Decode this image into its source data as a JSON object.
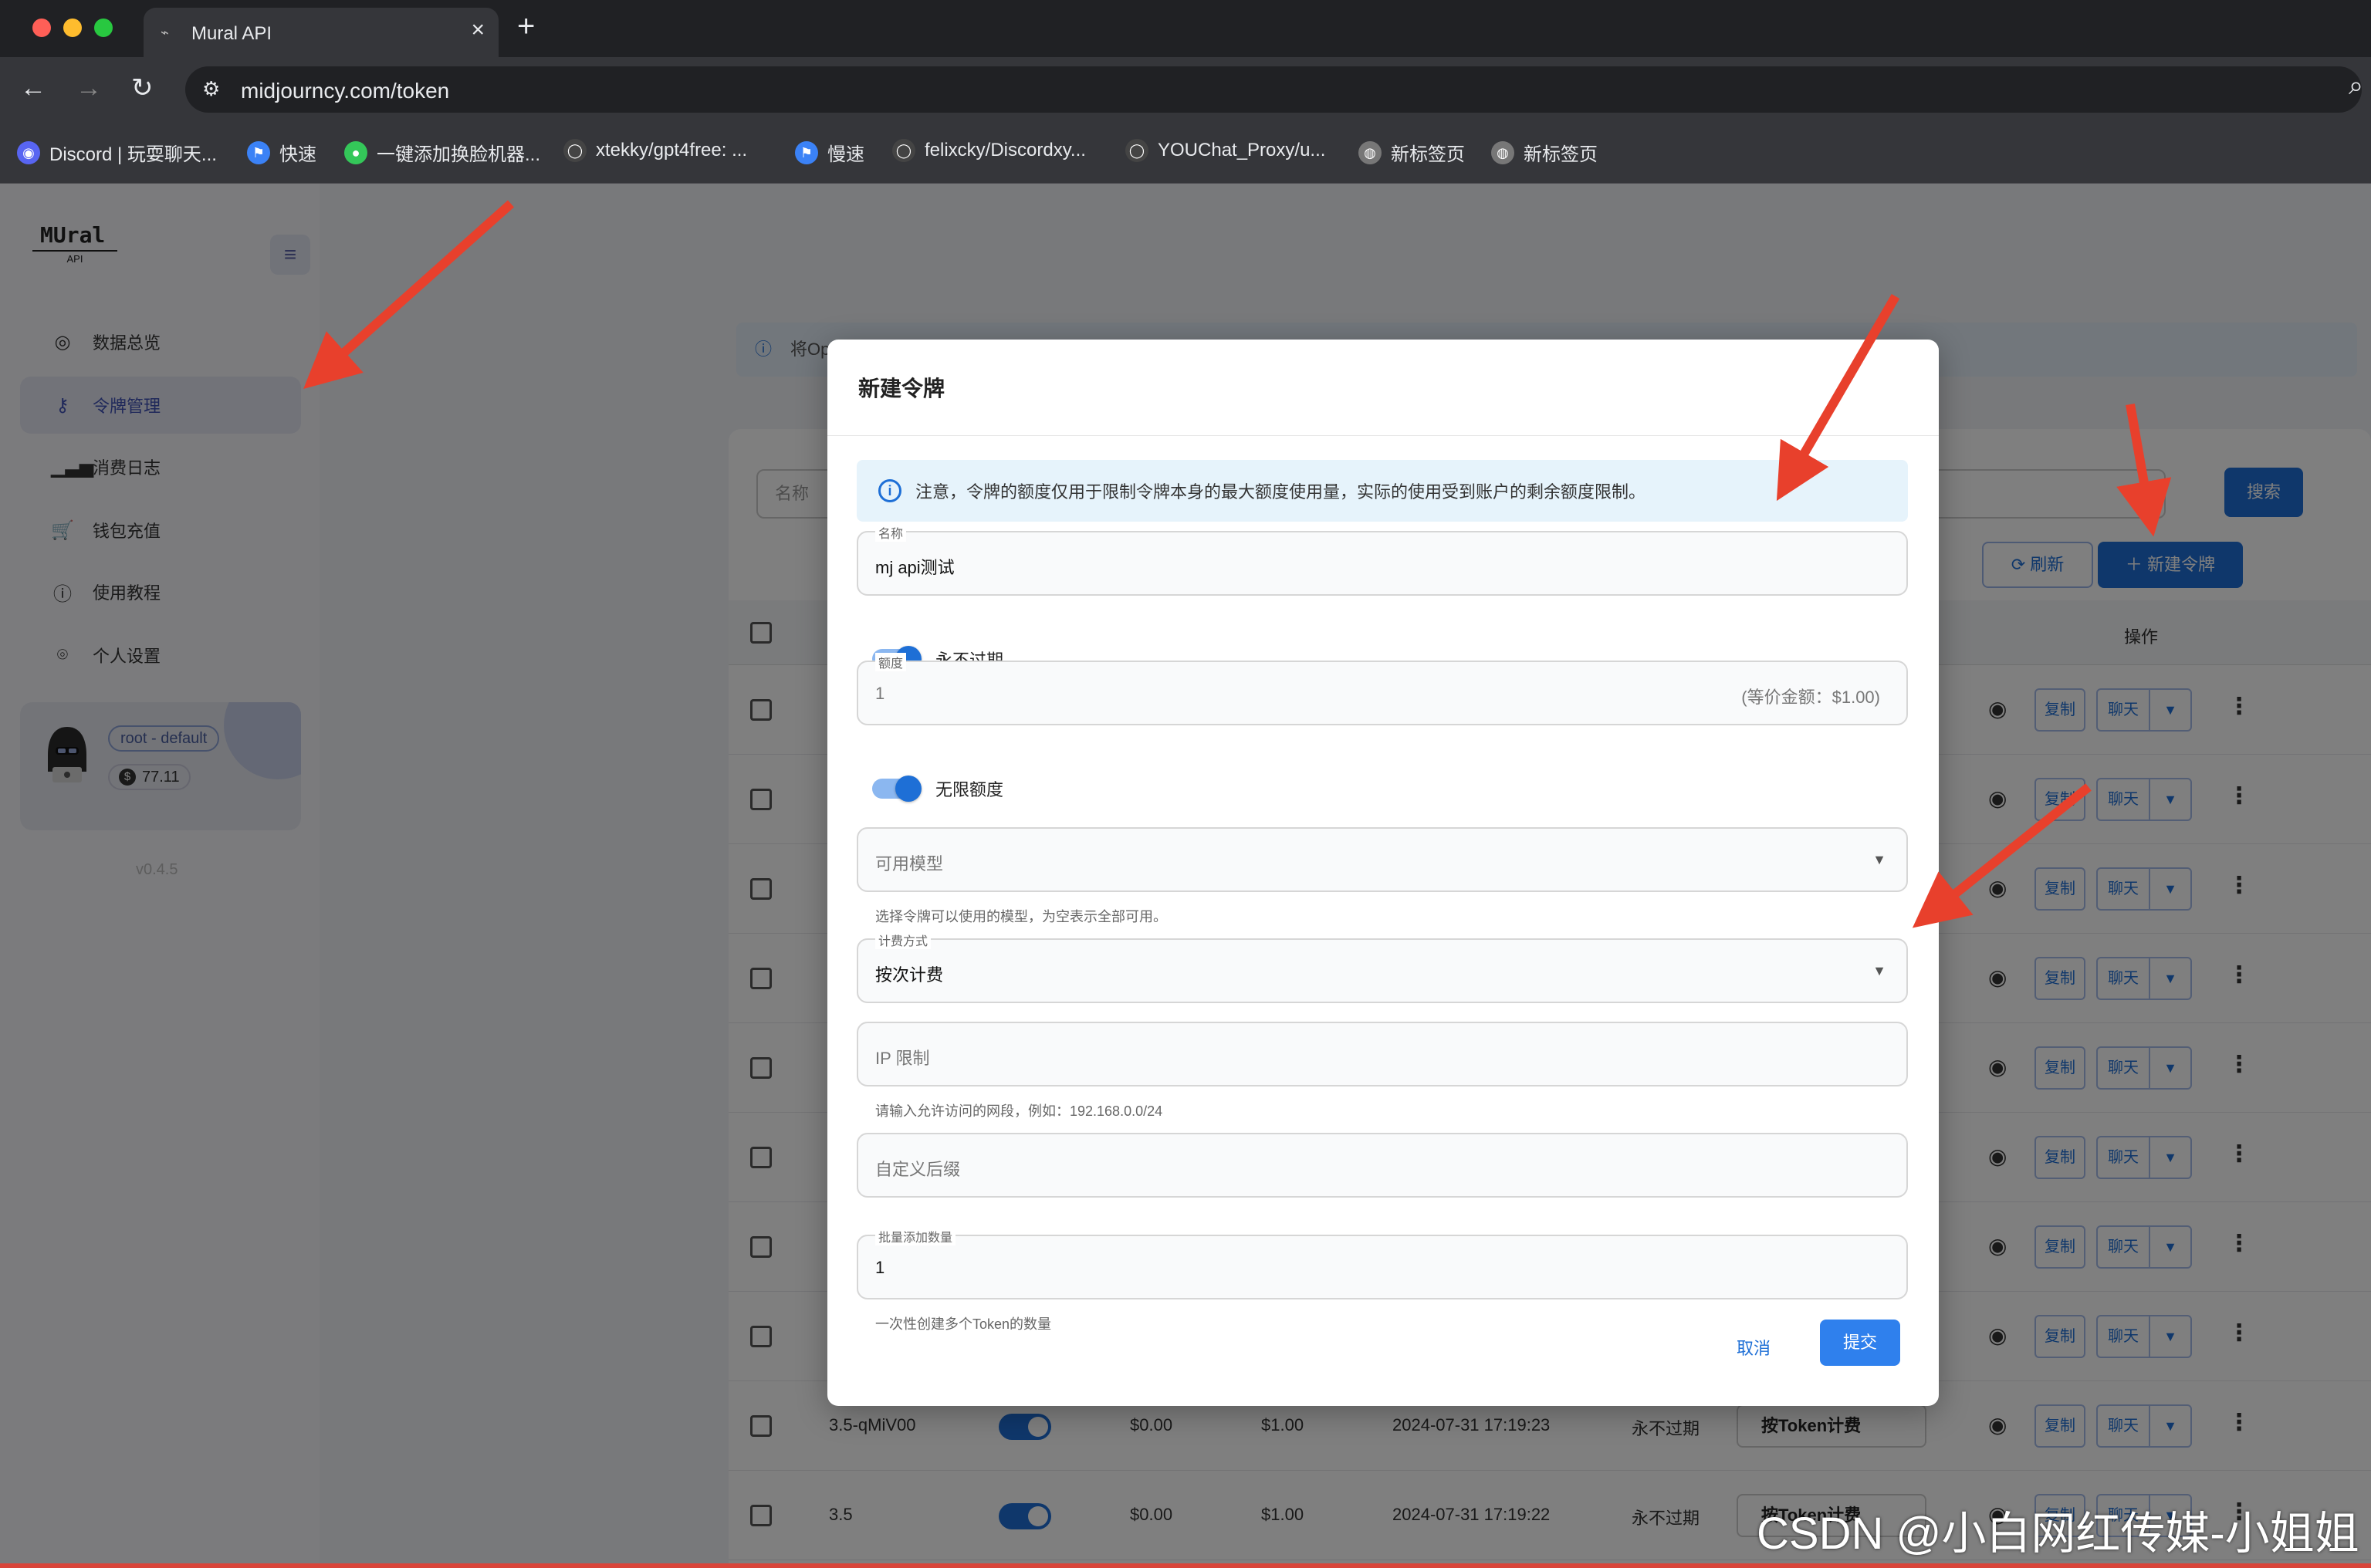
{
  "browser": {
    "tab_title": "Mural API",
    "url": "midjourncy.com/token",
    "bookmarks": [
      {
        "label": "Discord | 玩耍聊天...",
        "icon": "discord-icon",
        "color": "#5865f2"
      },
      {
        "label": "快速",
        "icon": "flag-icon",
        "color": "#3b82f6"
      },
      {
        "label": "一键添加换脸机器...",
        "icon": "leaf-icon",
        "color": "#34c759"
      },
      {
        "label": "xtekky/gpt4free: ...",
        "icon": "github-icon",
        "color": "#444444"
      },
      {
        "label": "慢速",
        "icon": "flag-icon",
        "color": "#3b82f6"
      },
      {
        "label": "felixcky/Discordxy...",
        "icon": "github-icon",
        "color": "#444444"
      },
      {
        "label": "YOUChat_Proxy/u...",
        "icon": "github-icon",
        "color": "#444444"
      },
      {
        "label": "新标签页",
        "icon": "globe-icon",
        "color": "#777777"
      },
      {
        "label": "新标签页",
        "icon": "globe-icon",
        "color": "#777777"
      }
    ]
  },
  "sidebar": {
    "logo": "MUral",
    "logo_sub": "API",
    "items": [
      {
        "label": "数据总览",
        "icon": "dashboard-icon",
        "glyph": "◎"
      },
      {
        "label": "令牌管理",
        "icon": "key-icon",
        "glyph": "⚷"
      },
      {
        "label": "消费日志",
        "icon": "bar-chart-icon",
        "glyph": "▁▃▅"
      },
      {
        "label": "钱包充值",
        "icon": "cart-icon",
        "glyph": "🛒"
      },
      {
        "label": "使用教程",
        "icon": "info-icon",
        "glyph": "ⓘ"
      },
      {
        "label": "个人设置",
        "icon": "user-settings-icon",
        "glyph": "⌾"
      }
    ],
    "active_index": 1,
    "user": {
      "role": "root - default",
      "balance": "77.11"
    },
    "version": "v0.4.5"
  },
  "background": {
    "banner_prefix": "将Op",
    "search_placeholder": "名称",
    "search_button": "搜索",
    "refresh_button": "刷新",
    "new_button": "新建令牌",
    "ops_header": "操作",
    "row_action_copy": "复制",
    "row_action_chat": "聊天",
    "rows": [
      {
        "name": "3.5-qMiV00",
        "used": "$0.00",
        "quota": "$1.00",
        "created": "2024-07-31 17:19:23",
        "expire": "永不过期",
        "billing": "按Token计费"
      },
      {
        "name": "3.5",
        "used": "$0.00",
        "quota": "$1.00",
        "created": "2024-07-31 17:19:22",
        "expire": "永不过期",
        "billing": "按Token计费"
      }
    ]
  },
  "modal": {
    "title": "新建令牌",
    "notice": "注意，令牌的额度仅用于限制令牌本身的最大额度使用量，实际的使用受到账户的剩余额度限制。",
    "name_label": "名称",
    "name_value": "mj api测试",
    "never_expire_label": "永不过期",
    "quota_label": "额度",
    "quota_value": "1",
    "quota_equiv": "(等价金额：$1.00)",
    "unlimited_label": "无限额度",
    "models_placeholder": "可用模型",
    "models_helper": "选择令牌可以使用的模型，为空表示全部可用。",
    "billing_label": "计费方式",
    "billing_value": "按次计费",
    "ip_placeholder": "IP 限制",
    "ip_helper": "请输入允许访问的网段，例如：192.168.0.0/24",
    "suffix_placeholder": "自定义后缀",
    "batch_label": "批量添加数量",
    "batch_value": "1",
    "batch_helper": "一次性创建多个Token的数量",
    "cancel": "取消",
    "submit": "提交"
  },
  "watermark": "CSDN @小白网红传媒-小姐姐",
  "colors": {
    "accent": "#1e6fd6",
    "arrow": "#e8402c"
  }
}
